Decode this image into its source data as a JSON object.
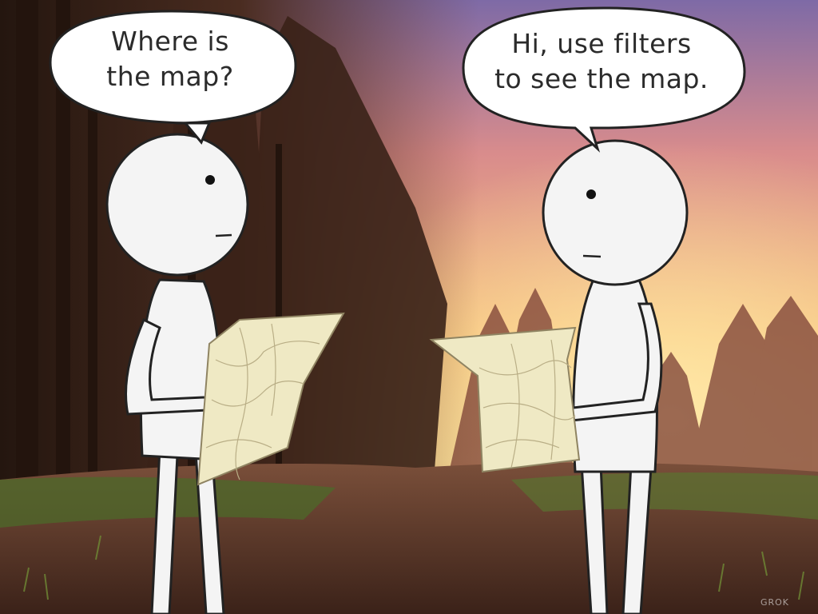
{
  "left_character": {
    "speech": "Where is\nthe map?"
  },
  "right_character": {
    "speech": "Hi, use filters\nto see the map."
  },
  "watermark": {
    "text": "GROK"
  },
  "colors": {
    "sky_top": "#8a6fa8",
    "sky_glow": "#f7c27a",
    "horizon": "#ffd98a",
    "forest_dark": "#3a2418",
    "ground": "#5b3a2a",
    "grass": "#4f6b2c",
    "figure": "#f4f4f4",
    "map_paper": "#f1ecc8"
  }
}
